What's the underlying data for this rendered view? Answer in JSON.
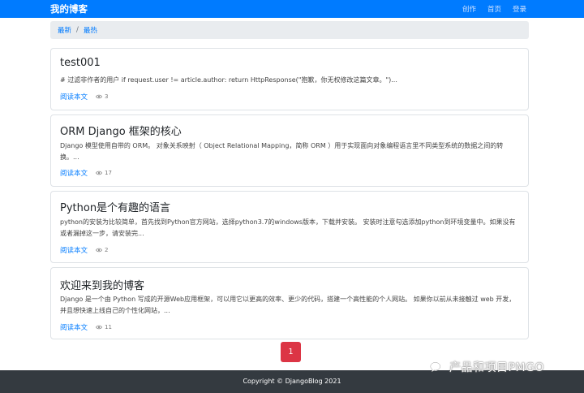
{
  "navbar": {
    "brand": "我的博客",
    "links": [
      "创作",
      "首页",
      "登录"
    ]
  },
  "breadcrumb": {
    "items": [
      "最新",
      "最热"
    ],
    "separator": "/"
  },
  "posts": [
    {
      "title": "test001",
      "excerpt": "# 过滤非作者的用户 if request.user != article.author: return HttpResponse(\"抱歉，你无权修改这篇文章。\")...",
      "read_label": "阅读本文",
      "views": "3"
    },
    {
      "title": "ORM Django 框架的核心",
      "excerpt": "Django 模型使用自带的 ORM。 对象关系映射（ Object Relational Mapping，简称 ORM ）用于实现面向对象编程语言里不同类型系统的数据之间的转换。...",
      "read_label": "阅读本文",
      "views": "17"
    },
    {
      "title": "Python是个有趣的语言",
      "excerpt": "python的安装为比较简单，首先找到Python官方网站，选择python3.7的windows版本，下载并安装。 安装时注意勾选添加python到环境变量中。如果没有或者漏掉这一步，请安装完...",
      "read_label": "阅读本文",
      "views": "2"
    },
    {
      "title": "欢迎来到我的博客",
      "excerpt": "Django 是一个由 Python 写成的开源Web应用框架，可以用它以更高的效率、更少的代码，搭建一个高性能的个人网站。 如果你以前从未接触过 web 开发，并且想快速上线自己的个性化网站，...",
      "read_label": "阅读本文",
      "views": "11"
    }
  ],
  "pagination": {
    "current": "1"
  },
  "footer": {
    "copyright": "Copyright © DjangoBlog 2021"
  },
  "watermark": {
    "text": "产品和项目PMGO"
  },
  "colors": {
    "primary": "#007bff",
    "danger": "#dc3545",
    "footer": "#343a40",
    "breadcrumb_bg": "#e9ecef"
  }
}
